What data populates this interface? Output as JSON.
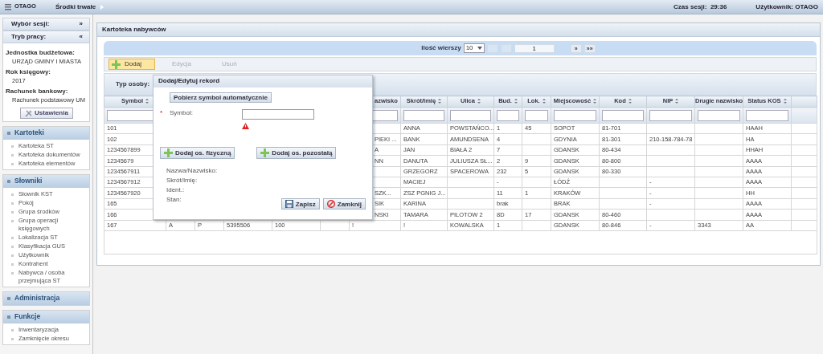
{
  "top_bar": {
    "app_name": "OTAGO",
    "module": "Środki trwałe",
    "session_label": "Czas sesji:",
    "session_time": "29:36",
    "user_label": "Użytkownik:",
    "user": "OTAGO"
  },
  "sidebar": {
    "headers": [
      {
        "label": "Wybór sesji:",
        "toggle": "»"
      },
      {
        "label": "Tryb pracy:",
        "toggle": "«"
      }
    ],
    "info": [
      {
        "label": "Jednostka budżetowa:",
        "value": "URZĄD GMINY I MIASTA"
      },
      {
        "label": "Rok księgowy:",
        "value": "2017"
      },
      {
        "label": "Rachunek bankowy:",
        "value": "Rachunek podstawowy UM"
      }
    ],
    "settings_button": "Ustawienia",
    "sections": [
      {
        "title": "Kartoteki",
        "items": [
          "Kartoteka ST",
          "Kartoteka dokumentów",
          "Kartoteka elementów"
        ]
      },
      {
        "title": "Słowniki",
        "items": [
          "Słownik KST",
          "Pokój",
          "Grupa środków",
          "Grupa operacji księgowych",
          "Lokalizacja ST",
          "Klasyfikacja GUS",
          "Użytkownik",
          "Kontrahent",
          "Nabywca / osoba przejmująca ST"
        ]
      },
      {
        "title": "Administracja"
      },
      {
        "title": "Funkcje",
        "items": [
          "Inwentaryzacja",
          "Zamknięcie okresu"
        ]
      }
    ]
  },
  "panel": {
    "title": "Kartoteka nabywców",
    "pager": {
      "rows_label": "Ilość wierszy",
      "rows_value": "10",
      "page": "1",
      "next": "»",
      "last": "»»"
    },
    "toolbar": [
      {
        "label": "Dodaj",
        "highlighted": true,
        "disabled": false
      },
      {
        "label": "Edycja",
        "highlighted": false,
        "disabled": true
      },
      {
        "label": "Usuń",
        "highlighted": false,
        "disabled": true
      }
    ],
    "filter_label": "Typ osoby:",
    "table": {
      "columns": [
        {
          "title": "Symbol",
          "sortable": true,
          "filter": true
        },
        {},
        {},
        {},
        {},
        {},
        {
          "title": "azwisko",
          "sortable": false,
          "filter": true
        },
        {
          "title": "Skrót/Imię",
          "sortable": true,
          "filter": true
        },
        {
          "title": "Ulica",
          "sortable": true,
          "filter": true
        },
        {
          "title": "Bud.",
          "sortable": true,
          "filter": true
        },
        {
          "title": "Lok.",
          "sortable": true,
          "filter": true
        },
        {
          "title": "Miejscowość",
          "sortable": true,
          "filter": true
        },
        {
          "title": "Kod",
          "sortable": true,
          "filter": true
        },
        {
          "title": "NIP",
          "sortable": true,
          "filter": true
        },
        {
          "title": "Drugie nazwisko",
          "sortable": false,
          "filter": true
        },
        {
          "title": "Status KOS",
          "sortable": true,
          "filter": true
        },
        {
          "filter": false
        }
      ],
      "rows": [
        [
          "101",
          null,
          null,
          null,
          null,
          null,
          null,
          "ANNA",
          "POWSTAŃCO...",
          "1",
          "45",
          "SOPOT",
          "81-701",
          null,
          null,
          "HAAH",
          null
        ],
        [
          "102",
          null,
          null,
          null,
          null,
          null,
          "PIEKI ...",
          "BANK",
          "AMUNDSENA",
          "4",
          null,
          "GDYNIA",
          "81-301",
          "210-158-784-78",
          null,
          "HA",
          null
        ],
        [
          "1234567899",
          null,
          null,
          null,
          null,
          null,
          "A",
          "JAN",
          "BIAŁA 2",
          "7",
          null,
          "GDANSK",
          "80-434",
          null,
          null,
          "HHAH",
          null
        ],
        [
          "12345679",
          null,
          null,
          null,
          null,
          null,
          "NN",
          "DANUTA",
          "JULIUSZA SŁ...",
          "2",
          "9",
          "GDANSK",
          "80-800",
          null,
          null,
          "AAAA",
          null
        ],
        [
          "1234567911",
          null,
          null,
          null,
          null,
          null,
          null,
          "GRZEGORZ",
          "SPACEROWA",
          "232",
          "5",
          "GDANSK",
          "80-330",
          null,
          null,
          "AAAA",
          null
        ],
        [
          "1234567912",
          null,
          null,
          null,
          null,
          null,
          null,
          "MACIEJ",
          null,
          "-",
          null,
          "ŁÓDŹ",
          null,
          "-",
          null,
          "AAAA",
          null
        ],
        [
          "1234567920",
          null,
          null,
          null,
          null,
          null,
          "SZK...",
          "ZSZ PGNIG J...",
          null,
          "11",
          "1",
          "KRAKÓW",
          null,
          "-",
          null,
          "HH",
          null
        ],
        [
          "165",
          null,
          null,
          null,
          null,
          null,
          "SIK",
          "KARINA",
          null,
          "brak",
          null,
          "BRAK",
          null,
          "-",
          null,
          "AAAA",
          null
        ],
        [
          "166",
          null,
          null,
          null,
          null,
          null,
          "NSKI",
          "TAMARA",
          "PILOTOW 2",
          "8D",
          "17",
          "GDANSK",
          "80-460",
          null,
          null,
          "AAAA",
          null
        ],
        [
          "167",
          "A",
          "P",
          "5395506",
          "100",
          null,
          "!",
          "!",
          "KOWALSKA",
          "1",
          null,
          "GDANSK",
          "80-846",
          "-",
          "3343",
          "AA",
          null
        ]
      ]
    }
  },
  "dialog": {
    "title": "Dodaj/Edytuj rekord",
    "auto_symbol_button": "Pobierz symbol automatycznie",
    "symbol": {
      "required_mark": "*",
      "label": "Symbol:",
      "invalid": true
    },
    "person_buttons": [
      "Dodaj os. fizyczną",
      "Dodaj os. pozostałą"
    ],
    "fields": [
      "Nazwa/Nazwisko:",
      "Skrót/Imię:",
      "Ident.:",
      "Stan:"
    ],
    "buttons": [
      {
        "label": "Zapisz",
        "kind": "save"
      },
      {
        "label": "Zamknij",
        "kind": "close"
      }
    ]
  }
}
